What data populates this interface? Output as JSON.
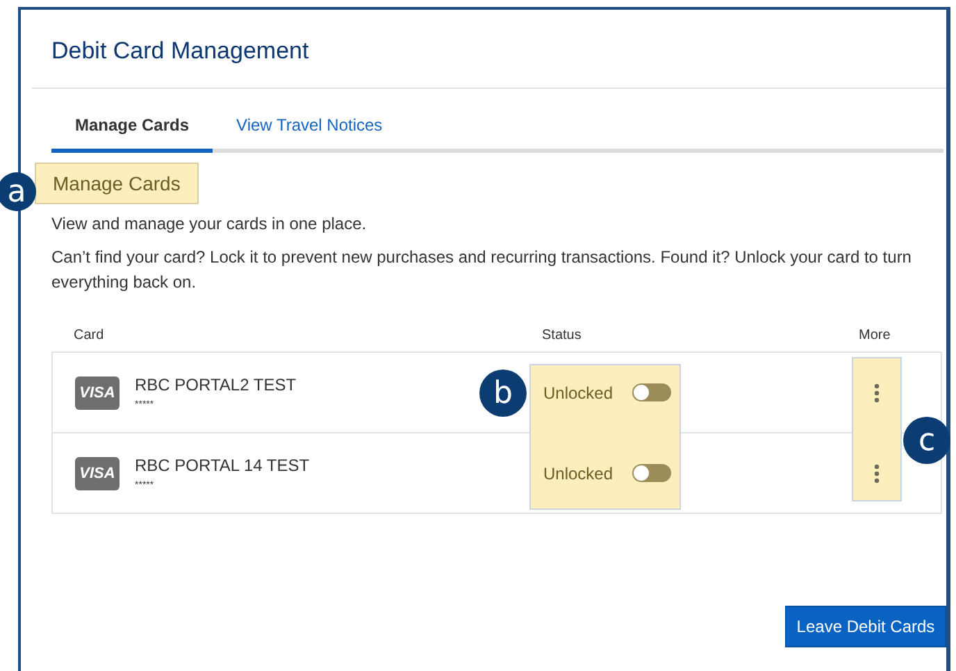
{
  "page": {
    "title": "Debit Card Management"
  },
  "tabs": [
    {
      "label": "Manage Cards",
      "selected": true
    },
    {
      "label": "View Travel Notices",
      "selected": false
    }
  ],
  "section": {
    "heading": "Manage Cards",
    "intro": "View and manage your cards in one place.",
    "help": "Can’t find your card? Lock it to prevent new purchases and recurring transactions. Found it? Unlock your card to turn everything back on."
  },
  "table": {
    "columns": [
      "Card",
      "Status",
      "More"
    ],
    "rows": [
      {
        "brand": "VISA",
        "name": "RBC PORTAL2 TEST",
        "number": "*****",
        "status": "Unlocked",
        "on": false
      },
      {
        "brand": "VISA",
        "name": "RBC PORTAL 14 TEST",
        "number": "*****",
        "status": "Unlocked",
        "on": false
      }
    ]
  },
  "button": "Leave Debit Cards",
  "callouts": [
    "a",
    "b",
    "c"
  ]
}
